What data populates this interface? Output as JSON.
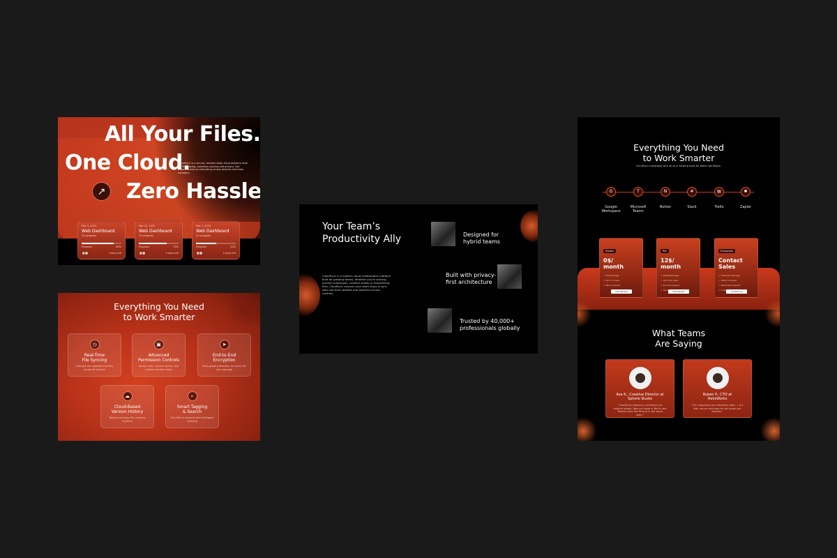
{
  "colors": {
    "background": "#1a1a1a",
    "accent": "#c23b1f",
    "dark_panel": "#000000"
  },
  "hero": {
    "headline_1": "All Your Files.",
    "headline_2": "One Cloud.",
    "headline_3": "Zero Hassle.",
    "description": "CloudSync is a secure, remote-ready cloud platform built for file sharing, seamless syncing and privacy. Get instant access to everything across devices and team members.",
    "cta_icon": "arrow-up-right-icon",
    "cards": [
      {
        "date": "Mar 5, 2025",
        "title": "Web Dashboard",
        "status": "On progress",
        "progress_label": "Progress",
        "progress_text": "80%",
        "progress": 0.8,
        "foot": "3 days left"
      },
      {
        "date": "Mar 10, 2025",
        "title": "Web Dashboard",
        "status": "On progress",
        "progress_label": "Progress",
        "progress_text": "70%",
        "progress": 0.7,
        "foot": "5 days left"
      },
      {
        "date": "Mar 1, 2025",
        "title": "Web Dashboard",
        "status": "On progress",
        "progress_label": "Progress",
        "progress_text": "50%",
        "progress": 0.5,
        "foot": "3 days left"
      }
    ]
  },
  "features": {
    "title_1": "Everything You Need",
    "title_2": "to Work Smarter",
    "items": [
      {
        "title_1": "Real-Time",
        "title_2": "File Syncing",
        "desc": "Changes are updated instantly across all devices",
        "icon": "clock-icon"
      },
      {
        "title_1": "Advanced",
        "title_2": "Permission Controls",
        "desc": "Assign roles, restrict access, and protect sensitive data",
        "icon": "lock-icon"
      },
      {
        "title_1": "End-to-End",
        "title_2": "Encryption",
        "desc": "Bank-grade protection for every file and message",
        "icon": "send-icon"
      },
      {
        "title_1": "Cloud-Based",
        "title_2": "Version History",
        "desc": "Restore previous file versions anytime",
        "icon": "cloud-icon"
      },
      {
        "title_1": "Smart Tagging",
        "title_2": "& Search",
        "desc": "Find files in seconds with intelligent indexing",
        "icon": "search-icon"
      }
    ]
  },
  "ally": {
    "title_1": "Your Team’s",
    "title_2": "Productivity Ally",
    "description": "CloudSync is a modern cloud collaboration platform built for growing teams. Whether you're sharing product prototypes, creative assets or engineering files, CloudSync ensures your team stays in sync with real-time updates and powerful access controls.",
    "points": [
      {
        "line_1": "Designed for",
        "line_2": "hybrid teams"
      },
      {
        "line_1": "Built with privacy-",
        "line_2": "first architecture"
      },
      {
        "line_1": "Trusted by 40,000+",
        "line_2": "professionals globally"
      }
    ]
  },
  "landing": {
    "title_1": "Everything You Need",
    "title_2": "to Work Smarter",
    "subtitle": "CloudSync integrates with all your existing tools for better workflows.",
    "integrations": [
      {
        "label_1": "Google",
        "label_2": "Workspace",
        "icon": "google-icon",
        "glyph": "G"
      },
      {
        "label_1": "Microsoft",
        "label_2": "Teams",
        "icon": "microsoft-teams-icon",
        "glyph": "T"
      },
      {
        "label_1": "Notion",
        "label_2": "",
        "icon": "notion-icon",
        "glyph": "N"
      },
      {
        "label_1": "Slack",
        "label_2": "",
        "icon": "slack-icon",
        "glyph": "#"
      },
      {
        "label_1": "Trello",
        "label_2": "",
        "icon": "trello-icon",
        "glyph": "▤"
      },
      {
        "label_1": "Zapier",
        "label_2": "",
        "icon": "zapier-icon",
        "glyph": "✱"
      }
    ],
    "pricing": [
      {
        "tag": "Starter",
        "amount_1": "0$/",
        "amount_2": "month",
        "features": [
          "5GB Storage",
          "Up to 3 users",
          "Basic Support"
        ],
        "cta": "Get Started"
      },
      {
        "tag": "Pro",
        "amount_1": "12$/",
        "amount_2": "month",
        "features": [
          "100GB Storage",
          "Up to 20 users",
          "Priority Support",
          "Version History"
        ],
        "cta": "Get Started"
      },
      {
        "tag": "Enterprise",
        "amount_1": "Contact",
        "amount_2": "Sales",
        "features": [
          "Unlimited Storage",
          "Admin Console",
          "Dedicated Support",
          "Custom SLA"
        ],
        "cta": "Contact Us"
      }
    ],
    "testimonials_title_1": "What Teams",
    "testimonials_title_2": "Are Saying",
    "testimonials": [
      {
        "who_1": "Ava K., Creative Director at",
        "who_2": "Sphere Studio",
        "quote": "“CloudSync helped us centralize our product assets. Now our team in Berlin and Toronto work like they’re in the same room.”"
      },
      {
        "who_1": "Ruben P., CTO at",
        "who_2": "HelixWorks",
        "quote": "“Our engineers use CloudSync daily — it’s fast, secure and easy to use across our devices.”"
      }
    ]
  }
}
